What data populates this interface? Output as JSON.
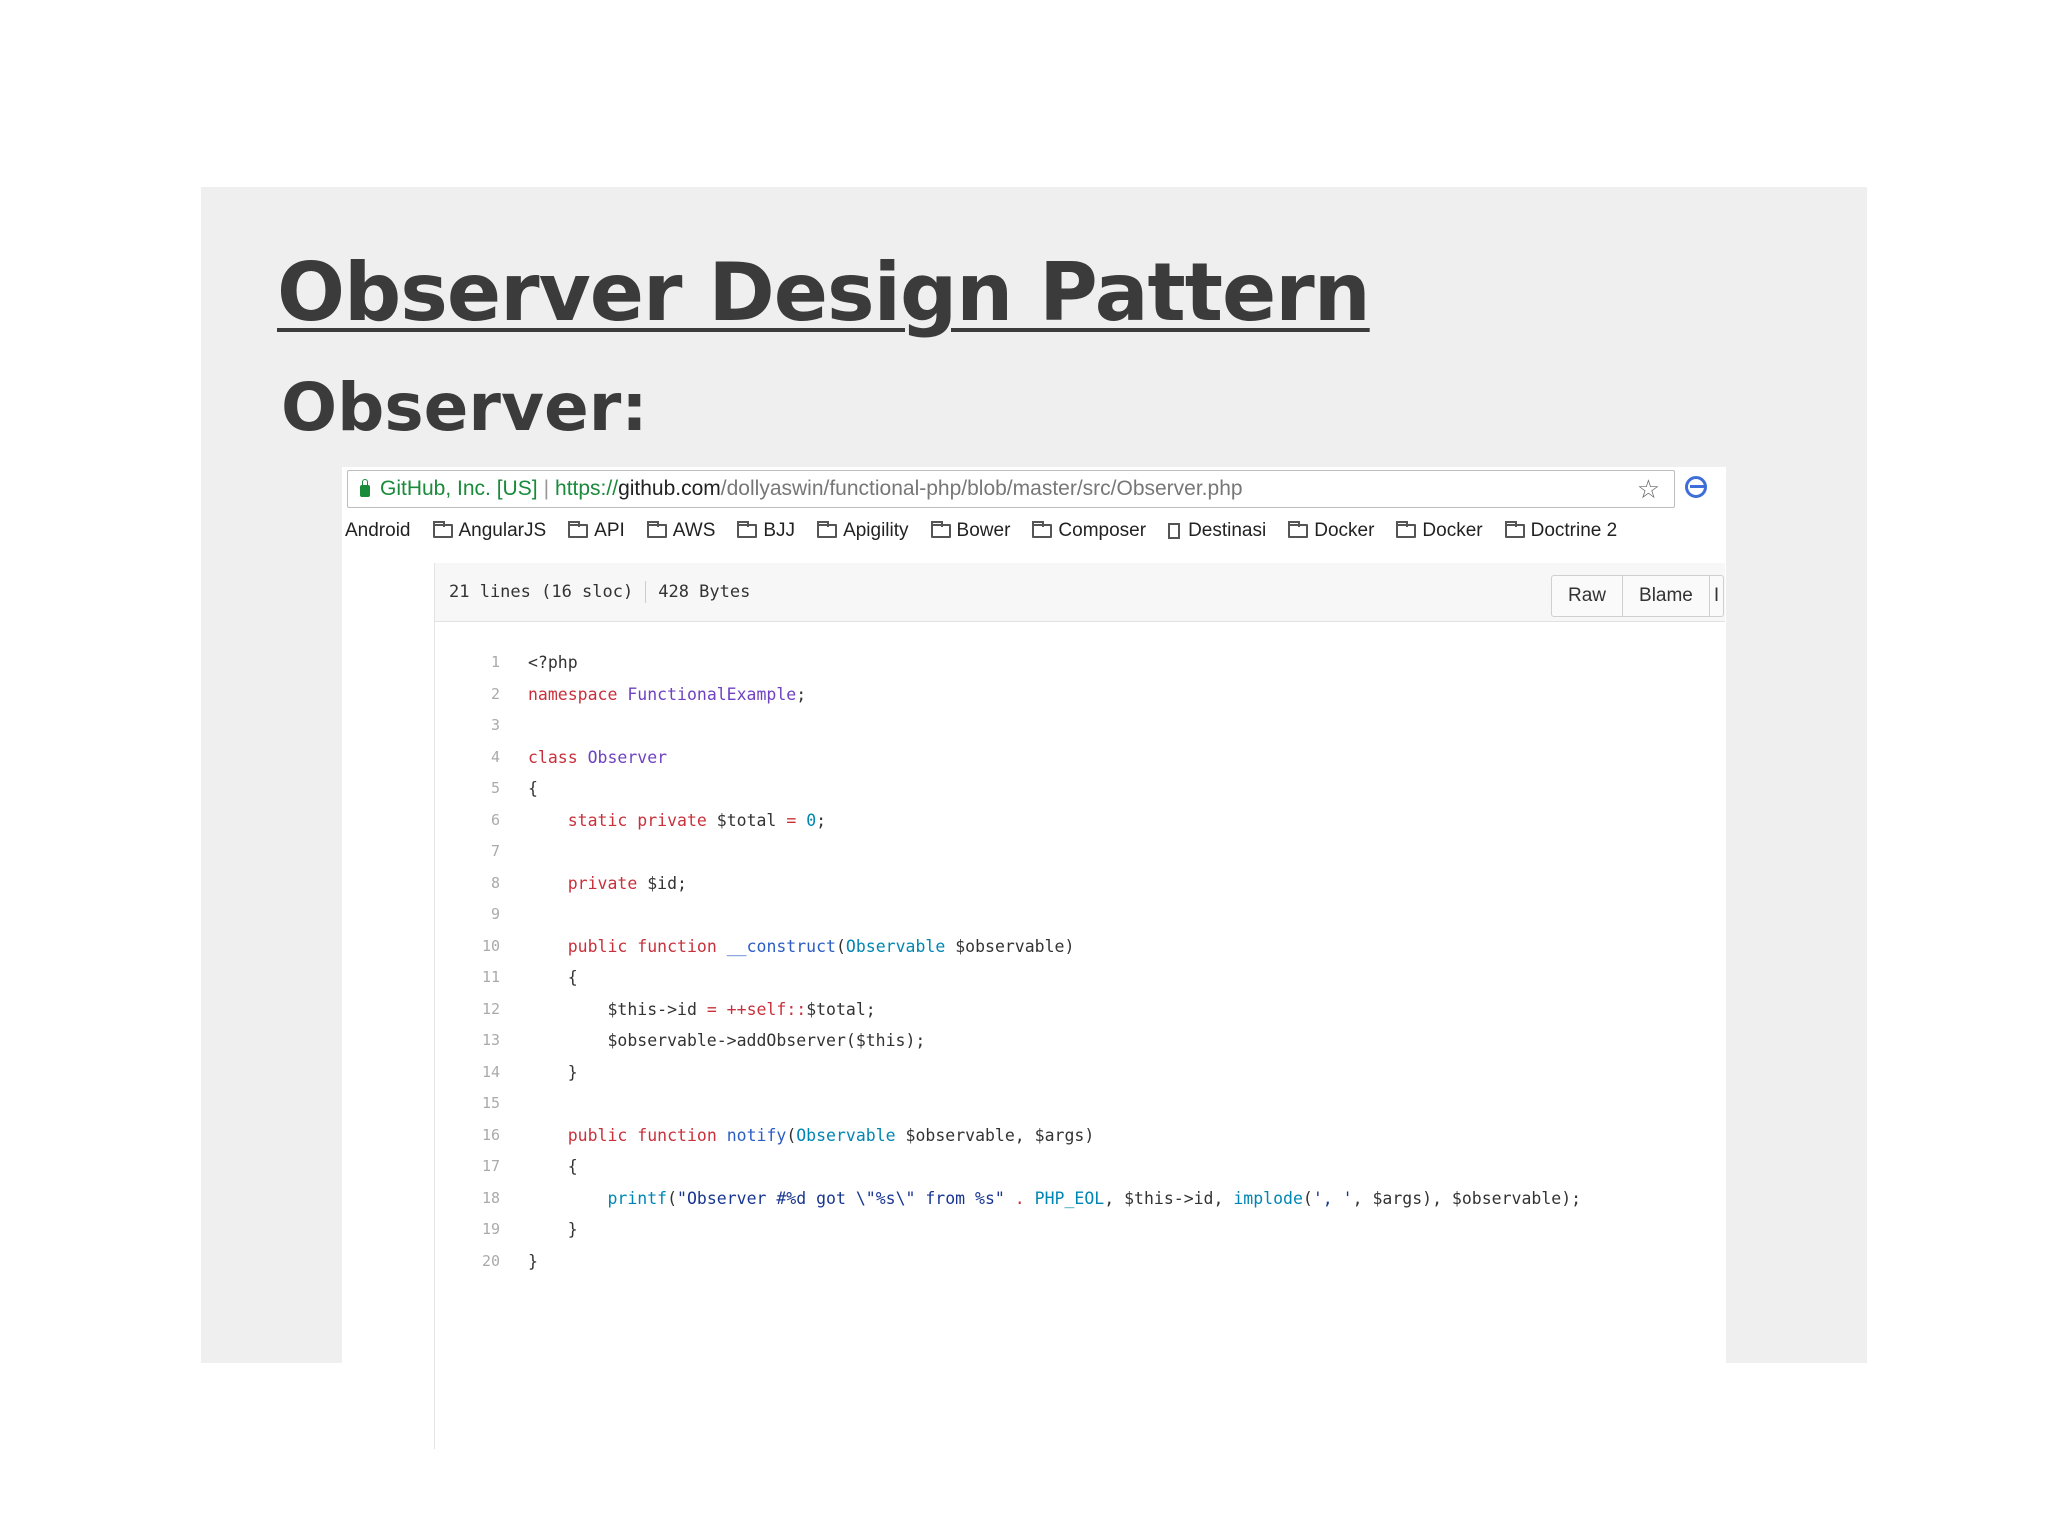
{
  "slide": {
    "title": "Observer Design Pattern",
    "subtitle": "Observer:"
  },
  "browser": {
    "site_owner": "GitHub, Inc. [US]",
    "url_scheme": "https://",
    "url_host": "github.com",
    "url_path": "/dollyaswin/functional-php/blob/master/src/Observer.php",
    "star_icon": "star-icon",
    "bookmarks": [
      {
        "label": "Android",
        "icon": "none"
      },
      {
        "label": "AngularJS",
        "icon": "folder-icon"
      },
      {
        "label": "API",
        "icon": "folder-icon"
      },
      {
        "label": "AWS",
        "icon": "folder-icon"
      },
      {
        "label": "BJJ",
        "icon": "folder-icon"
      },
      {
        "label": "Apigility",
        "icon": "folder-icon"
      },
      {
        "label": "Bower",
        "icon": "folder-icon"
      },
      {
        "label": "Composer",
        "icon": "folder-icon"
      },
      {
        "label": "Destinasi",
        "icon": "page-icon"
      },
      {
        "label": "Docker",
        "icon": "folder-icon"
      },
      {
        "label": "Docker",
        "icon": "folder-icon"
      },
      {
        "label": "Doctrine 2",
        "icon": "folder-icon"
      }
    ]
  },
  "file": {
    "lines_info": "21 lines (16 sloc)",
    "size_info": "428 Bytes",
    "buttons": [
      "Raw",
      "Blame",
      "I"
    ]
  },
  "code_lines": [
    {
      "n": "1",
      "tokens": [
        {
          "t": "<?php",
          "c": ""
        }
      ]
    },
    {
      "n": "2",
      "tokens": [
        {
          "t": "namespace ",
          "c": "k"
        },
        {
          "t": "FunctionalExample",
          "c": "t"
        },
        {
          "t": ";",
          "c": ""
        }
      ]
    },
    {
      "n": "3",
      "tokens": []
    },
    {
      "n": "4",
      "tokens": [
        {
          "t": "class ",
          "c": "k"
        },
        {
          "t": "Observer",
          "c": "t"
        }
      ]
    },
    {
      "n": "5",
      "tokens": [
        {
          "t": "{",
          "c": ""
        }
      ]
    },
    {
      "n": "6",
      "tokens": [
        {
          "t": "    ",
          "c": ""
        },
        {
          "t": "static private ",
          "c": "k"
        },
        {
          "t": "$total ",
          "c": ""
        },
        {
          "t": "= ",
          "c": "k"
        },
        {
          "t": "0",
          "c": "c"
        },
        {
          "t": ";",
          "c": ""
        }
      ]
    },
    {
      "n": "7",
      "tokens": []
    },
    {
      "n": "8",
      "tokens": [
        {
          "t": "    ",
          "c": ""
        },
        {
          "t": "private ",
          "c": "k"
        },
        {
          "t": "$id;",
          "c": ""
        }
      ]
    },
    {
      "n": "9",
      "tokens": []
    },
    {
      "n": "10",
      "tokens": [
        {
          "t": "    ",
          "c": ""
        },
        {
          "t": "public function ",
          "c": "k"
        },
        {
          "t": "__construct",
          "c": "f"
        },
        {
          "t": "(",
          "c": ""
        },
        {
          "t": "Observable ",
          "c": "c"
        },
        {
          "t": "$observable)",
          "c": ""
        }
      ]
    },
    {
      "n": "11",
      "tokens": [
        {
          "t": "    {",
          "c": ""
        }
      ]
    },
    {
      "n": "12",
      "tokens": [
        {
          "t": "        $this->id ",
          "c": ""
        },
        {
          "t": "= ++",
          "c": "k"
        },
        {
          "t": "self",
          "c": "k"
        },
        {
          "t": "::",
          "c": "k"
        },
        {
          "t": "$total;",
          "c": ""
        }
      ]
    },
    {
      "n": "13",
      "tokens": [
        {
          "t": "        $observable->addObserver($this);",
          "c": ""
        }
      ]
    },
    {
      "n": "14",
      "tokens": [
        {
          "t": "    }",
          "c": ""
        }
      ]
    },
    {
      "n": "15",
      "tokens": []
    },
    {
      "n": "16",
      "tokens": [
        {
          "t": "    ",
          "c": ""
        },
        {
          "t": "public function ",
          "c": "k"
        },
        {
          "t": "notify",
          "c": "f"
        },
        {
          "t": "(",
          "c": ""
        },
        {
          "t": "Observable ",
          "c": "c"
        },
        {
          "t": "$observable, $args)",
          "c": ""
        }
      ]
    },
    {
      "n": "17",
      "tokens": [
        {
          "t": "    {",
          "c": ""
        }
      ]
    },
    {
      "n": "18",
      "tokens": [
        {
          "t": "        ",
          "c": ""
        },
        {
          "t": "printf",
          "c": "c"
        },
        {
          "t": "(",
          "c": ""
        },
        {
          "t": "\"Observer #%d got \\\"%s\\\" from %s\" ",
          "c": "s"
        },
        {
          "t": ". ",
          "c": "k"
        },
        {
          "t": "PHP_EOL",
          "c": "c"
        },
        {
          "t": ", $this->id, ",
          "c": ""
        },
        {
          "t": "implode",
          "c": "c"
        },
        {
          "t": "(",
          "c": ""
        },
        {
          "t": "', '",
          "c": "s"
        },
        {
          "t": ", $args), $observable);",
          "c": ""
        }
      ]
    },
    {
      "n": "19",
      "tokens": [
        {
          "t": "    }",
          "c": ""
        }
      ]
    },
    {
      "n": "20",
      "tokens": [
        {
          "t": "}",
          "c": ""
        }
      ]
    }
  ]
}
